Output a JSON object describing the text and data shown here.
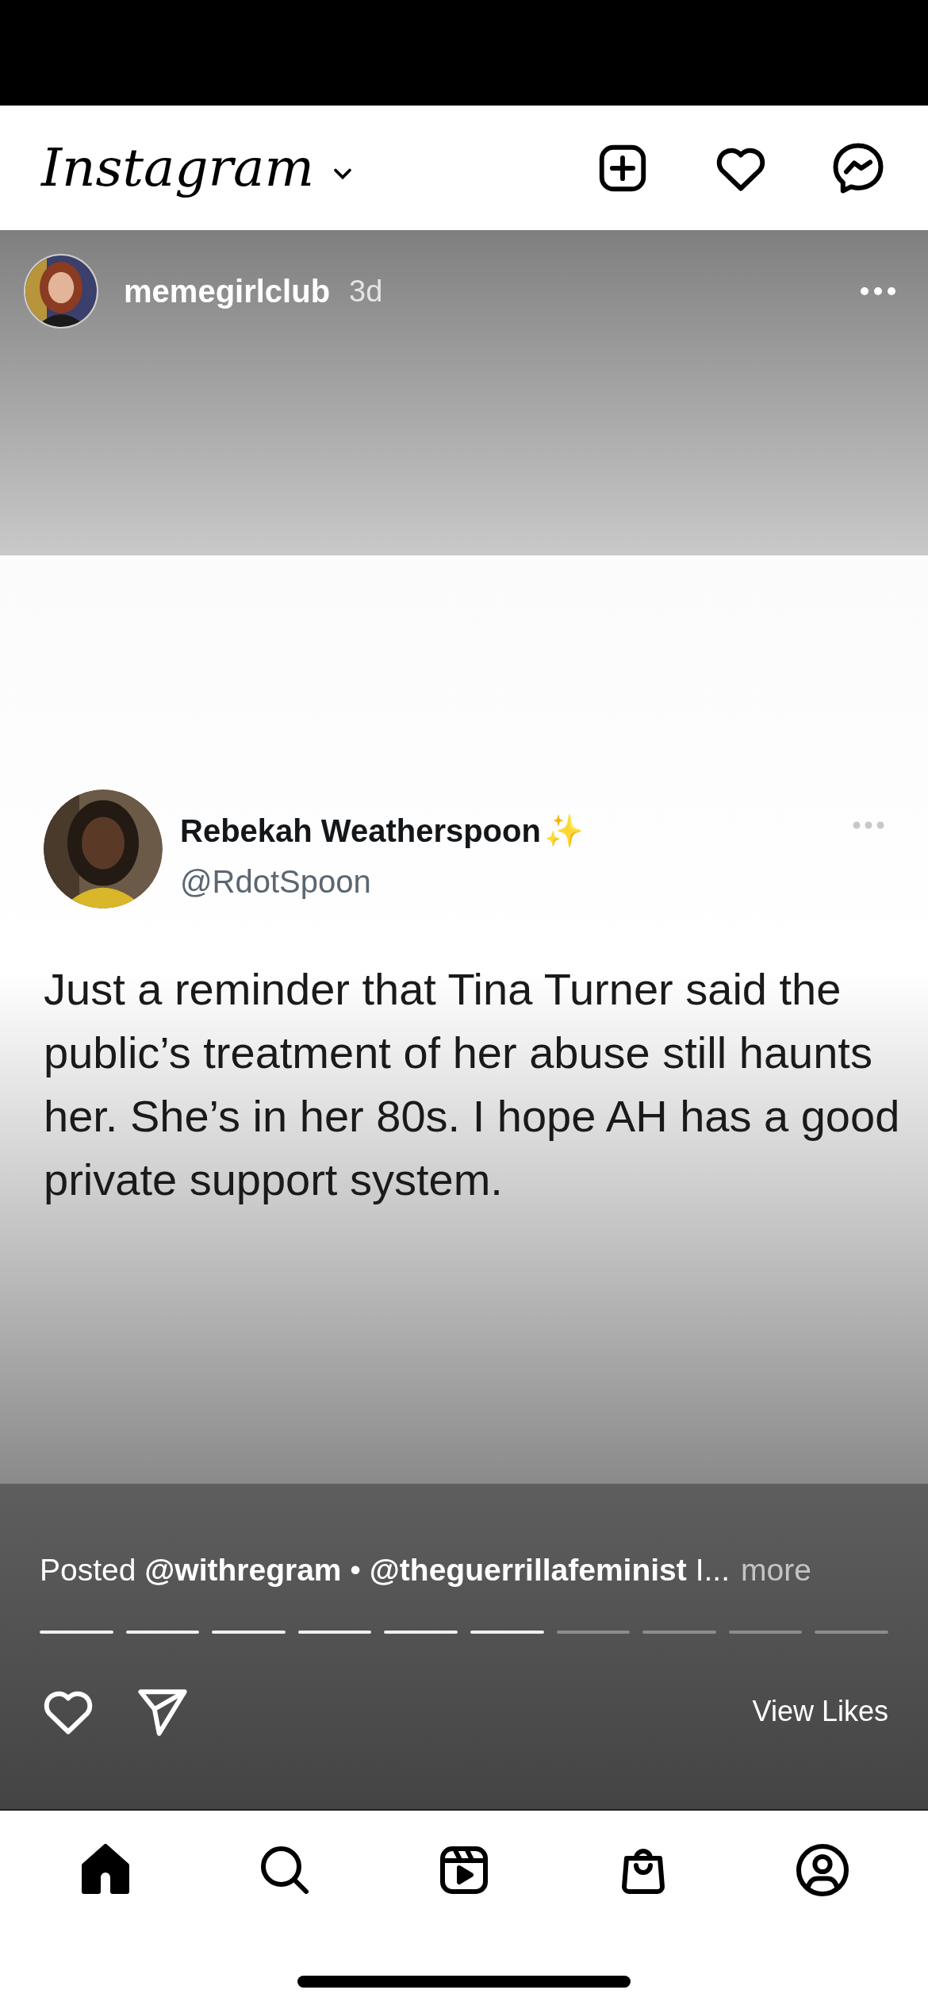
{
  "app_bar": {
    "logo": "Instagram"
  },
  "post": {
    "username": "memegirlclub",
    "time": "3d",
    "tweet": {
      "name": "Rebekah Weatherspoon",
      "name_emoji": "✨",
      "handle": "@RdotSpoon",
      "text": "Just a reminder that Tina Turner said the public’s treatment of her abuse still haunts her. She’s in her 80s. I hope AH has a good private support system."
    },
    "caption": "Posted **@withregram** • **@theguerrillafeminist** I...",
    "more": "more",
    "progress": [
      {
        "seen": true
      },
      {
        "seen": true
      },
      {
        "seen": true
      },
      {
        "seen": true
      },
      {
        "seen": true
      },
      {
        "seen": true
      },
      {
        "seen": false
      },
      {
        "seen": false
      },
      {
        "seen": false
      },
      {
        "seen": false
      }
    ],
    "liked": false,
    "view_likes": "View Likes"
  },
  "nav": [
    {
      "kind": "home",
      "selected": true
    },
    {
      "kind": "search",
      "selected": false
    },
    {
      "kind": "reels",
      "selected": false
    },
    {
      "kind": "shop",
      "selected": false
    },
    {
      "kind": "profile",
      "selected": false
    }
  ]
}
